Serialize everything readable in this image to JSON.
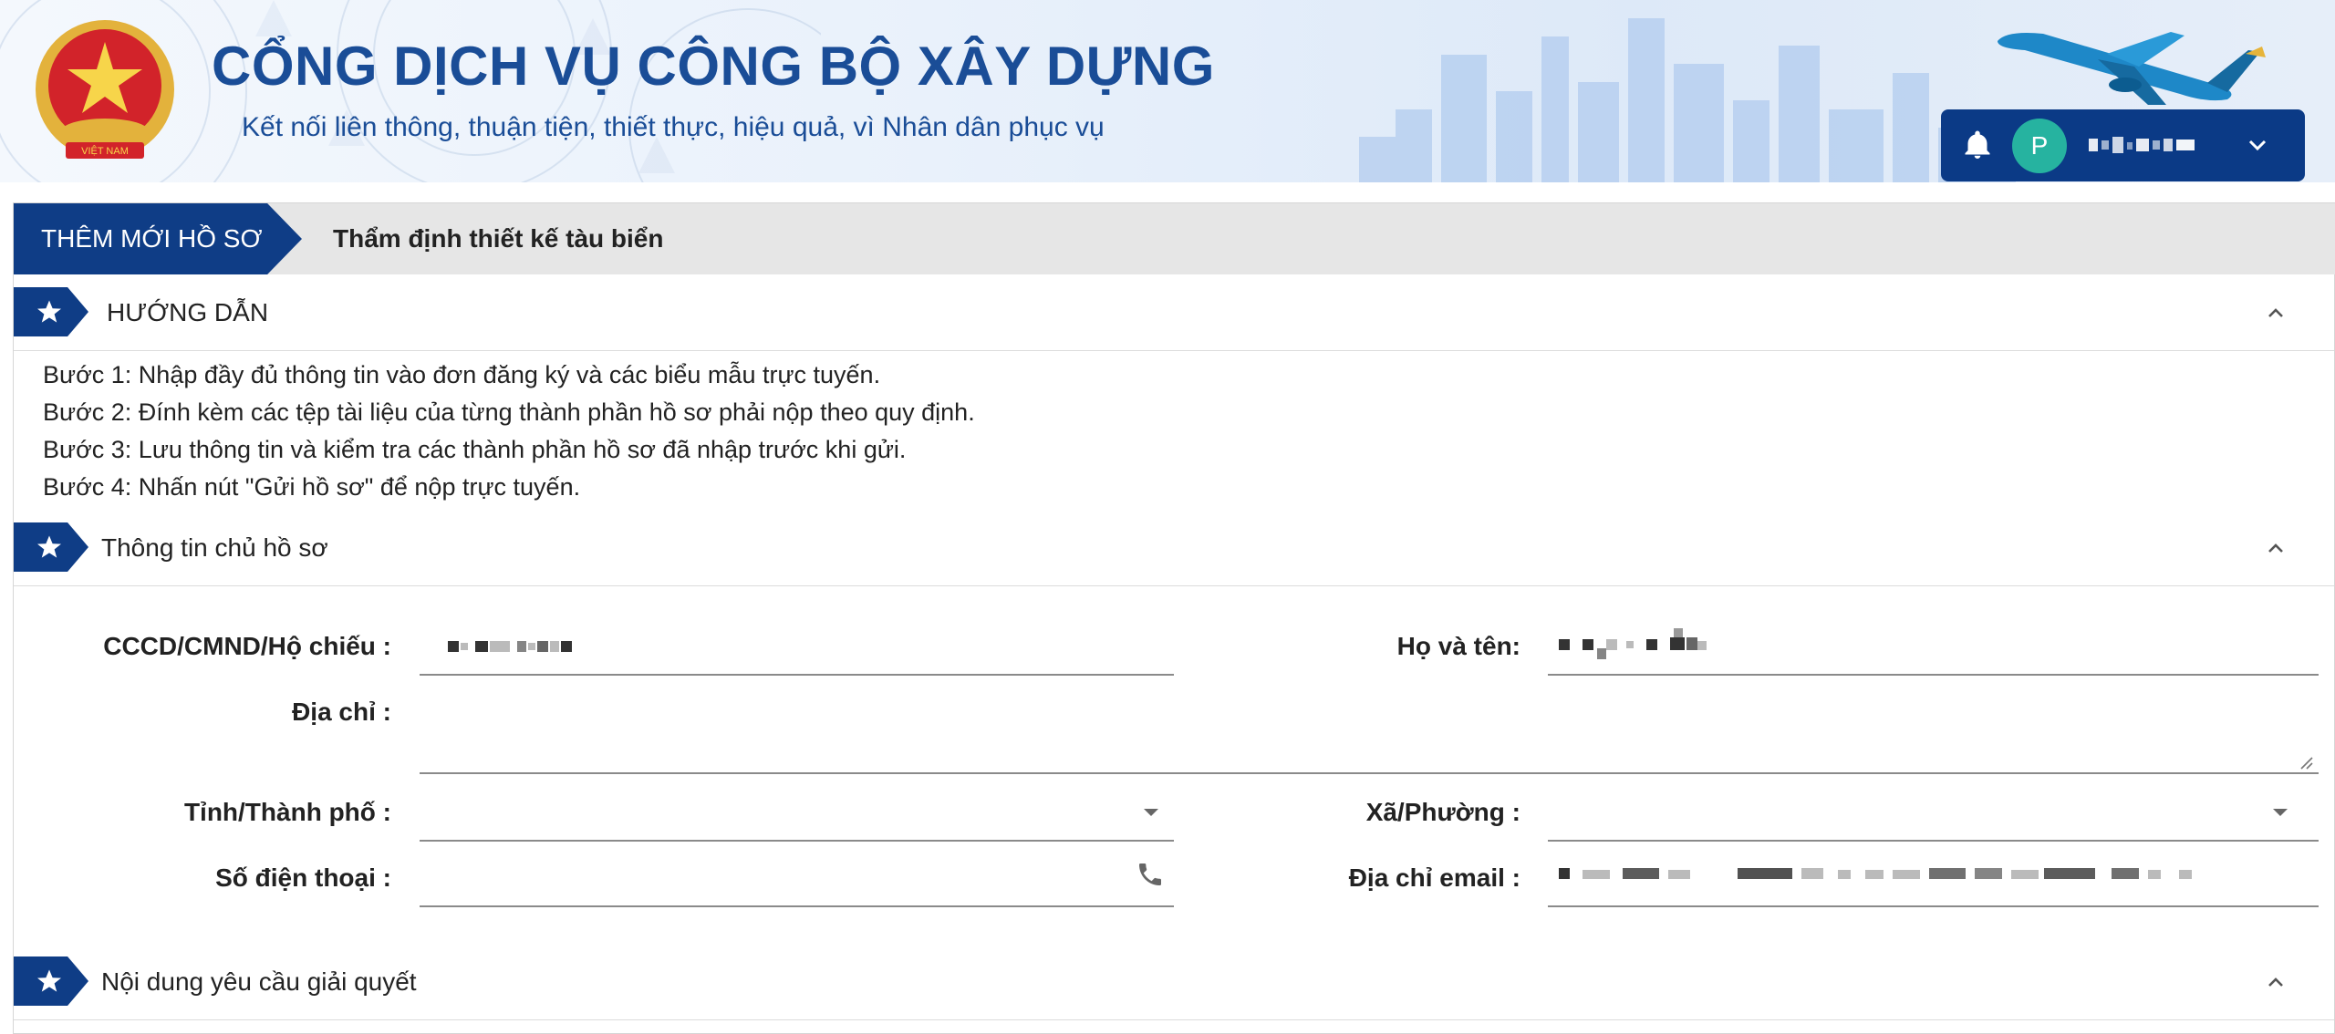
{
  "header": {
    "title": "CỔNG DỊCH VỤ CÔNG BỘ XÂY DỰNG",
    "slogan": "Kết nối liên thông, thuận tiện, thiết thực, hiệu quả, vì Nhân dân phục vụ",
    "emblem_text": "VIỆT NAM",
    "user": {
      "avatar_initial": "P",
      "username_blurred": true
    }
  },
  "breadcrumb": {
    "action": "THÊM MỚI HỒ SƠ",
    "procedure": "Thẩm định thiết kế tàu biển"
  },
  "guide": {
    "title": "HƯỚNG DẪN",
    "steps": [
      "Bước 1: Nhập đầy đủ thông tin vào đơn đăng ký và các biểu mẫu trực tuyến.",
      "Bước 2: Đính kèm các tệp tài liệu của từng thành phần hồ sơ phải nộp theo quy định.",
      "Bước 3: Lưu thông tin và kiểm tra các thành phần hồ sơ đã nhập trước khi gửi.",
      "Bước 4: Nhấn nút \"Gửi hồ sơ\" để nộp trực tuyến."
    ]
  },
  "owner_info": {
    "title": "Thông tin chủ hồ sơ",
    "fields": {
      "id_label": "CCCD/CMND/Hộ chiếu :",
      "name_label": "Họ và tên:",
      "address_label": "Địa chỉ :",
      "province_label": "Tỉnh/Thành phố :",
      "ward_label": "Xã/Phường :",
      "phone_label": "Số điện thoại :",
      "email_label": "Địa chỉ email :"
    }
  },
  "request": {
    "title": "Nội dung yêu cầu giải quyết"
  },
  "colors": {
    "brand_blue": "#0f3d86",
    "title_blue": "#1a4d97",
    "avatar_teal": "#26b3a0"
  }
}
